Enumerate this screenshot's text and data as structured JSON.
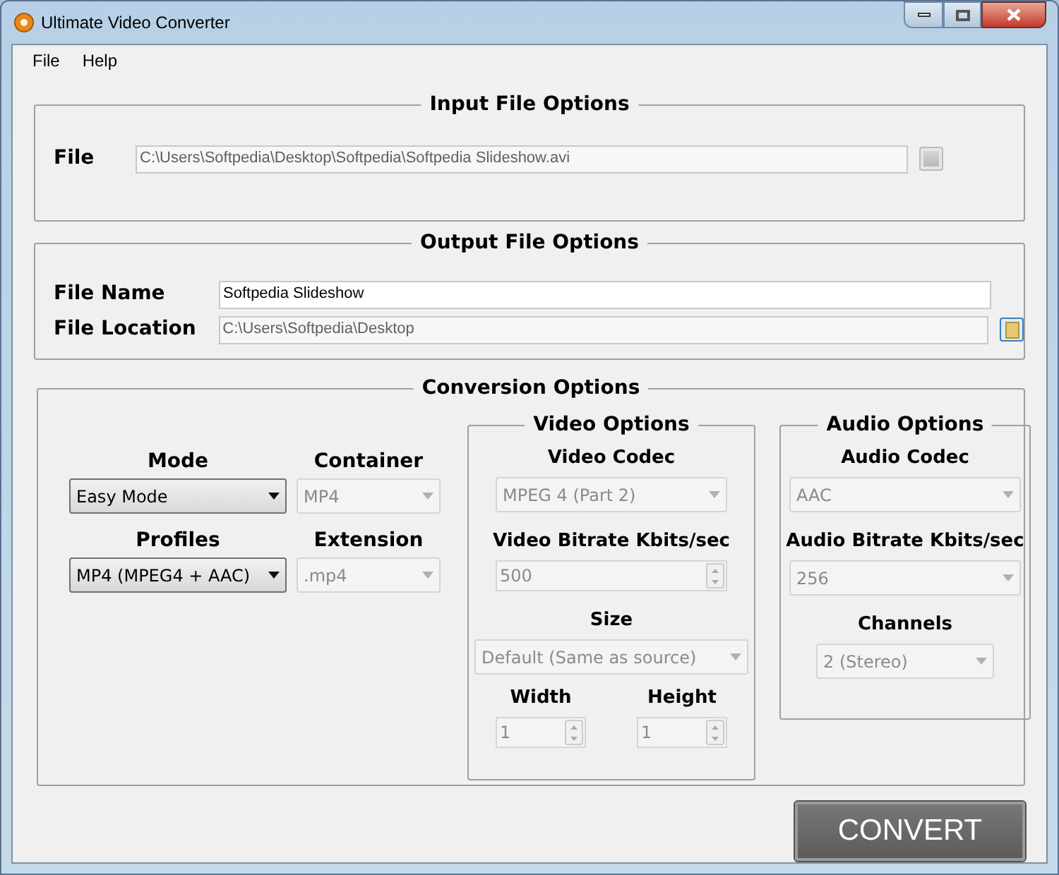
{
  "window": {
    "title": "Ultimate Video Converter"
  },
  "menu": [
    {
      "label": "File"
    },
    {
      "label": "Help"
    }
  ],
  "input_file_options": {
    "title": "Input File Options",
    "rows": [
      {
        "label": "File",
        "kind": "text",
        "value": "C:\\Users\\Softpedia\\Desktop\\Softpedia\\Softpedia Slideshow.avi",
        "disabled": true,
        "browse_disabled": true
      }
    ]
  },
  "output_file_options": {
    "title": "Output File Options",
    "rows": [
      {
        "label": "File Name",
        "kind": "text",
        "value": "Softpedia Slideshow",
        "disabled": false
      },
      {
        "label": "File Location",
        "kind": "text",
        "value": "C:\\Users\\Softpedia\\Desktop",
        "disabled": true,
        "browse_disabled": false
      }
    ]
  },
  "conversion_options": {
    "title": "Conversion Options",
    "general": [
      {
        "label": "Mode",
        "kind": "combo",
        "value": "Easy Mode",
        "disabled": false
      },
      {
        "label": "Container",
        "kind": "combo",
        "value": "MP4",
        "disabled": true
      },
      {
        "label": "Profiles",
        "kind": "combo",
        "value": "MP4 (MPEG4 + AAC)",
        "disabled": false
      },
      {
        "label": "Extension",
        "kind": "combo",
        "value": ".mp4",
        "disabled": true
      }
    ],
    "video_options": {
      "title": "Video Options",
      "fields": [
        {
          "label": "Video Codec",
          "kind": "combo",
          "value": "MPEG 4 (Part 2)",
          "disabled": true
        },
        {
          "label": "Video Bitrate Kbits/sec",
          "kind": "spin",
          "value": "500",
          "disabled": true
        },
        {
          "label": "Size",
          "kind": "combo",
          "value": "Default (Same as source)",
          "disabled": true
        },
        {
          "label": "Width",
          "kind": "spin",
          "value": "1",
          "disabled": true
        },
        {
          "label": "Height",
          "kind": "spin",
          "value": "1",
          "disabled": true
        }
      ]
    },
    "audio_options": {
      "title": "Audio Options",
      "fields": [
        {
          "label": "Audio Codec",
          "kind": "combo",
          "value": "AAC",
          "disabled": true
        },
        {
          "label": "Audio Bitrate Kbits/sec",
          "kind": "combo",
          "value": "256",
          "disabled": true
        },
        {
          "label": "Channels",
          "kind": "combo",
          "value": "2 (Stereo)",
          "disabled": true
        }
      ]
    }
  },
  "convert_button": {
    "label": "CONVERT"
  }
}
